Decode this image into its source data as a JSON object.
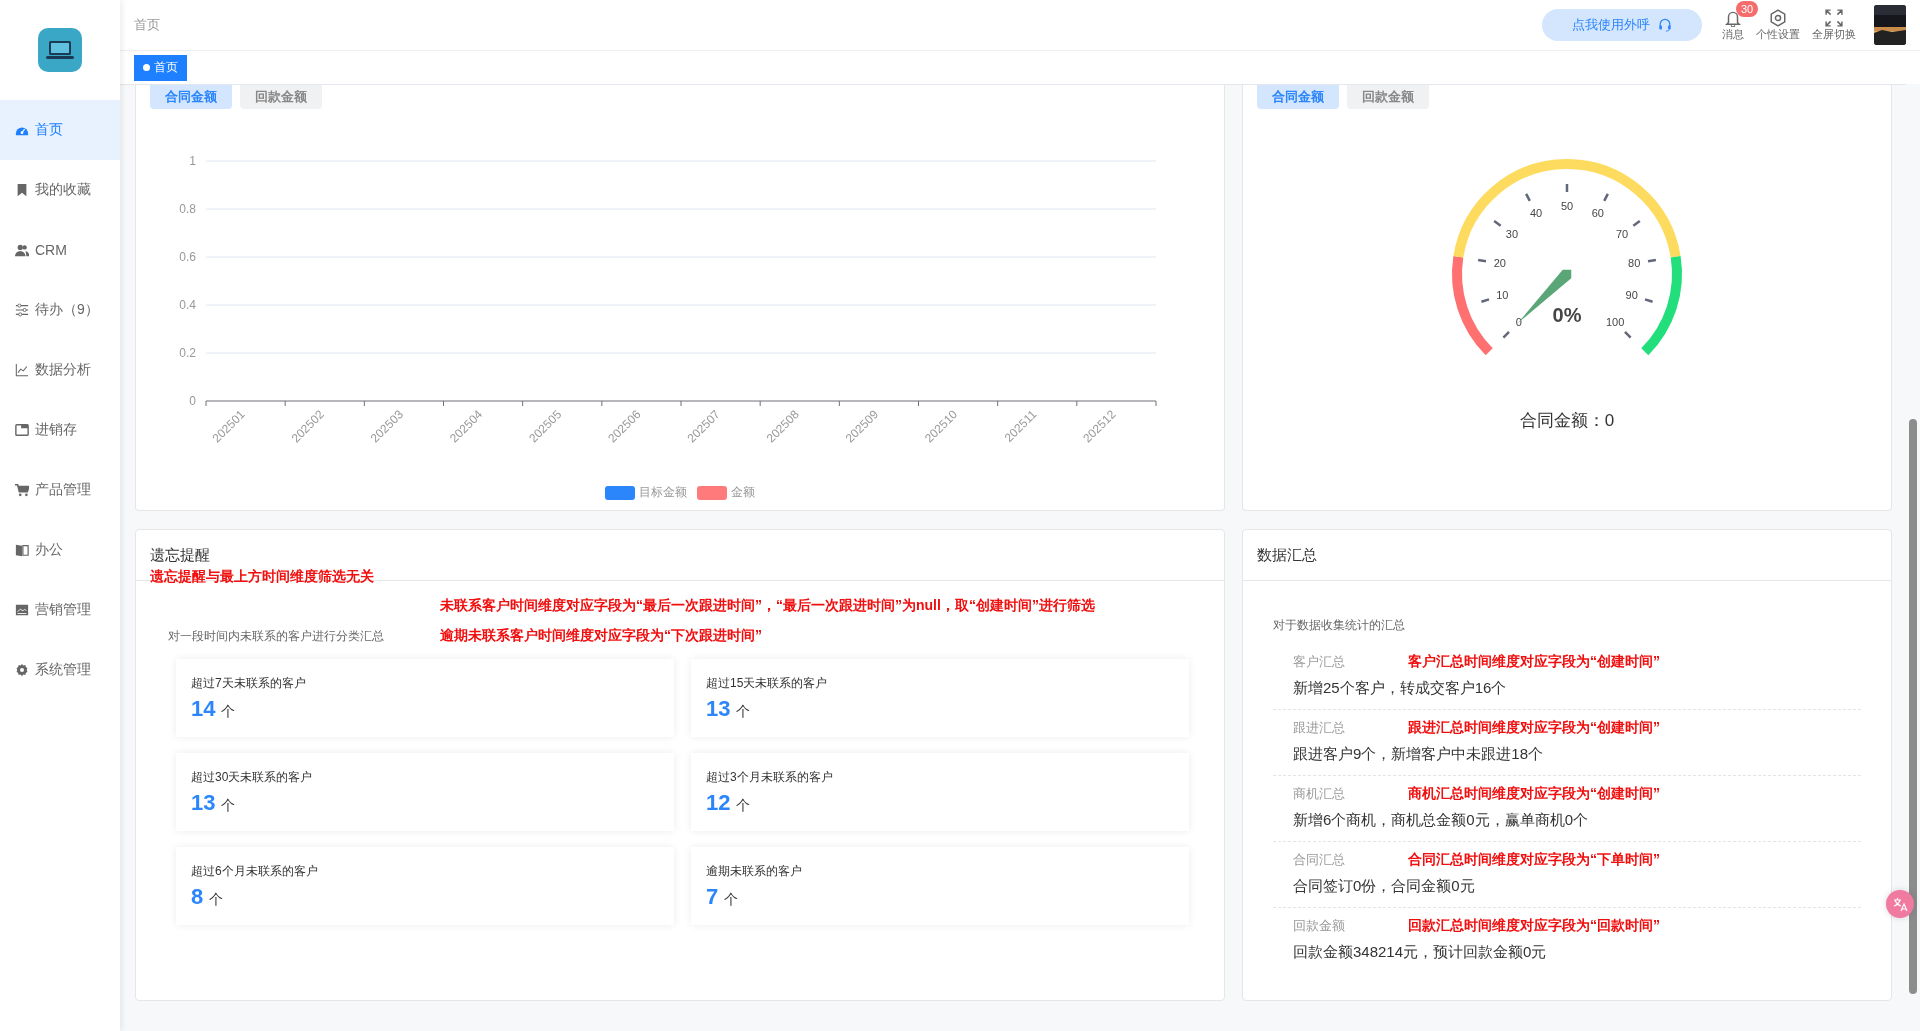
{
  "sidebar": {
    "items": [
      {
        "label": "首页",
        "selected": true
      },
      {
        "label": "我的收藏",
        "selected": false
      },
      {
        "label": "CRM",
        "selected": false
      },
      {
        "label": "待办（9）",
        "selected": false
      },
      {
        "label": "数据分析",
        "selected": false
      },
      {
        "label": "进销存",
        "selected": false
      },
      {
        "label": "产品管理",
        "selected": false
      },
      {
        "label": "办公",
        "selected": false
      },
      {
        "label": "营销管理",
        "selected": false
      },
      {
        "label": "系统管理",
        "selected": false
      }
    ]
  },
  "header": {
    "breadcrumb": "首页",
    "call_button": "点我使用外呼",
    "actions": [
      {
        "kind": "bell",
        "label": "消息",
        "badge": "30"
      },
      {
        "kind": "settings",
        "label": "个性设置"
      },
      {
        "kind": "fullscreen",
        "label": "全屏切换"
      }
    ]
  },
  "tags": [
    {
      "label": "首页",
      "selected": true
    }
  ],
  "contract_chart_card": {
    "tabs": [
      {
        "label": "合同金额",
        "selected": true
      },
      {
        "label": "回款金额",
        "selected": false
      }
    ],
    "chart_data": {
      "type": "bar",
      "categories": [
        "202501",
        "202502",
        "202503",
        "202504",
        "202505",
        "202506",
        "202507",
        "202508",
        "202509",
        "202510",
        "202511",
        "202512"
      ],
      "series": [
        {
          "name": "目标金额",
          "color": "#2b85fb",
          "values": [
            0,
            0,
            0,
            0,
            0,
            0,
            0,
            0,
            0,
            0,
            0,
            0
          ]
        },
        {
          "name": "金额",
          "color": "#ff7b7b",
          "values": [
            0,
            0,
            0,
            0,
            0,
            0,
            0,
            0,
            0,
            0,
            0,
            0
          ]
        }
      ],
      "ylim": [
        0,
        1
      ],
      "yticks": [
        0,
        0.2,
        0.4,
        0.6,
        0.8,
        1
      ],
      "grid": true
    }
  },
  "gauge_card": {
    "tabs": [
      {
        "label": "合同金额",
        "selected": true
      },
      {
        "label": "回款金额",
        "selected": false
      }
    ],
    "reading": "0%",
    "ticks": [
      "0",
      "10",
      "20",
      "30",
      "40",
      "50",
      "60",
      "70",
      "80",
      "90",
      "100"
    ],
    "caption": "合同金额：0"
  },
  "reminder_card": {
    "title": "遗忘提醒",
    "notes": [
      "遗忘提醒与最上方时间维度筛选无关",
      "未联系客户时间维度对应字段为“最后一次跟进时间”，“最后一次跟进时间”为null，取“创建时间”进行筛选",
      "逾期未联系客户时间维度对应字段为“下次跟进时间”"
    ],
    "subtitle": "对一段时间内未联系的客户进行分类汇总",
    "stats": [
      {
        "label": "超过7天未联系的客户",
        "value": "14",
        "unit": "个"
      },
      {
        "label": "超过15天未联系的客户",
        "value": "13",
        "unit": "个"
      },
      {
        "label": "超过30天未联系的客户",
        "value": "13",
        "unit": "个"
      },
      {
        "label": "超过3个月未联系的客户",
        "value": "12",
        "unit": "个"
      },
      {
        "label": "超过6个月未联系的客户",
        "value": "8",
        "unit": "个"
      },
      {
        "label": "逾期未联系的客户",
        "value": "7",
        "unit": "个"
      }
    ]
  },
  "summary_card": {
    "title": "数据汇总",
    "subtitle": "对于数据收集统计的汇总",
    "items": [
      {
        "label": "客户汇总",
        "note": "客户汇总时间维度对应字段为“创建时间”",
        "value": "新增25个客户，转成交客户16个"
      },
      {
        "label": "跟进汇总",
        "note": "跟进汇总时间维度对应字段为“创建时间”",
        "value": "跟进客户9个，新增客户中未跟进18个"
      },
      {
        "label": "商机汇总",
        "note": "商机汇总时间维度对应字段为“创建时间”",
        "value": "新增6个商机，商机总金额0元，赢单商机0个"
      },
      {
        "label": "合同汇总",
        "note": "合同汇总时间维度对应字段为“下单时间”",
        "value": "合同签订0份，合同金额0元"
      },
      {
        "label": "回款金额",
        "note": "回款汇总时间维度对应字段为“回款时间”",
        "value": "回款金额348214元，预计回款金额0元"
      }
    ]
  }
}
